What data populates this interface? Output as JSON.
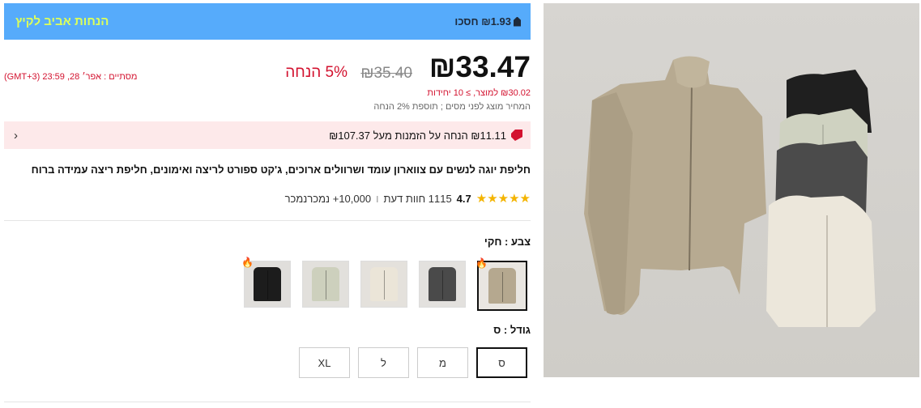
{
  "banner": {
    "title": "הנחות אביב לקיץ",
    "save_text": "₪1.93 חסכו"
  },
  "price": {
    "current": "₪33.47",
    "old": "₪35.40",
    "discount": "5% הנחה",
    "deadline": "מסתיים : אפר׳ 28, 23:59 (GMT+3)",
    "unit_price": "₪30.02 למוצר, ≥ 10 יחידות",
    "tax_note": "המחיר מוצג לפני מסים ; תוספת 2% הנחה"
  },
  "coupon": {
    "text": "₪11.11 הנחה על הזמנות מעל ₪107.37",
    "chevron": "›"
  },
  "product": {
    "title": "חליפת יוגה לנשים עם צווארון עומד ושרוולים ארוכים, ג'קט ספורט לריצה ואימונים, חליפת ריצה עמידה ברוח"
  },
  "rating": {
    "stars": "★★★★★",
    "value": "4.7",
    "reviews": "1115 חוות דעת",
    "separator": "ו",
    "sold": "10,000+ נמכרנמכר"
  },
  "color": {
    "label": "צבע : חקי",
    "swatches": [
      "khaki",
      "dark-gray",
      "cream",
      "light-green",
      "black"
    ],
    "hot_icon": "fire"
  },
  "size": {
    "label": "גודל : ס",
    "options": [
      "ס",
      "מ",
      "ל",
      "XL"
    ]
  },
  "colors": {
    "banner": "#56abfb",
    "accent_red": "#d3122f",
    "banner_title": "#dcff5a"
  }
}
